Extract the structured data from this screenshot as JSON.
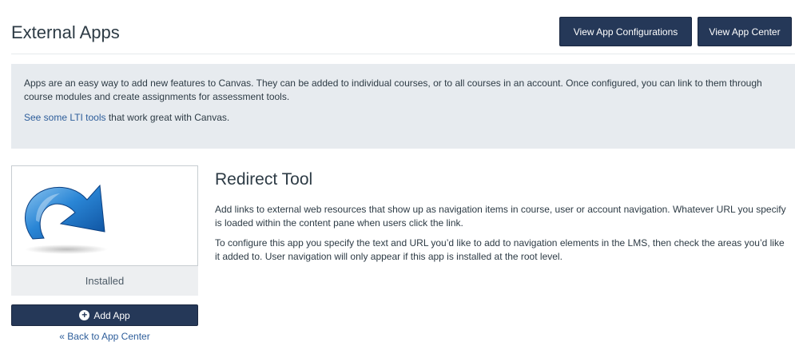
{
  "header": {
    "title": "External Apps",
    "view_configurations_label": "View App Configurations",
    "view_app_center_label": "View App Center"
  },
  "info": {
    "paragraph": "Apps are an easy way to add new features to Canvas. They can be added to individual courses, or to all courses in an account. Once configured, you can link to them through course modules and create assignments for assessment tools.",
    "link_text": "See some LTI tools",
    "link_suffix": " that work great with Canvas."
  },
  "app": {
    "logo_icon": "redirect-arrow-icon",
    "status": "Installed",
    "add_label": "Add App",
    "back_label": "« Back to App Center",
    "name": "Redirect Tool",
    "description_1": "Add links to external web resources that show up as navigation items in course, user or account navigation. Whatever URL you specify is loaded within the content pane when users click the link.",
    "description_2": "To configure this app you specify the text and URL you’d like to add to navigation elements in the LMS, then check the areas you’d like it added to. User navigation will only appear if this app is installed at the root level."
  },
  "colors": {
    "primary_button": "#253858",
    "info_background": "#e7ebef",
    "link": "#2d5d9a"
  }
}
